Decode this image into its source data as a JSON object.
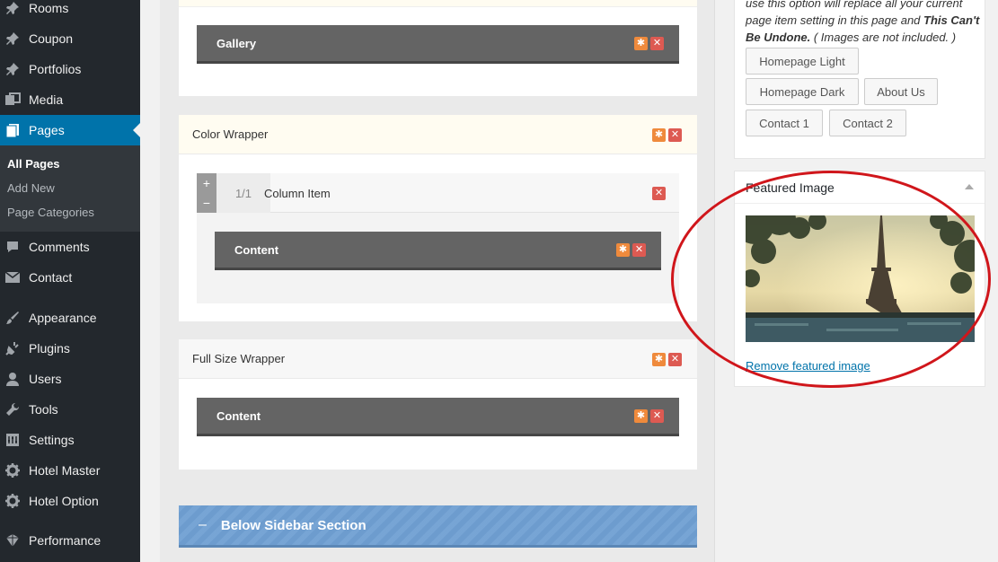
{
  "sidebar": {
    "items": [
      {
        "label": "Rooms",
        "icon": "pin-icon"
      },
      {
        "label": "Coupon",
        "icon": "pin-icon"
      },
      {
        "label": "Portfolios",
        "icon": "pin-icon"
      },
      {
        "label": "Media",
        "icon": "media-icon"
      },
      {
        "label": "Pages",
        "icon": "pages-icon"
      },
      {
        "label": "Comments",
        "icon": "comments-icon"
      },
      {
        "label": "Contact",
        "icon": "envelope-icon"
      },
      {
        "label": "Appearance",
        "icon": "brush-icon"
      },
      {
        "label": "Plugins",
        "icon": "plug-icon"
      },
      {
        "label": "Users",
        "icon": "user-icon"
      },
      {
        "label": "Tools",
        "icon": "wrench-icon"
      },
      {
        "label": "Settings",
        "icon": "settings-icon"
      },
      {
        "label": "Hotel Master",
        "icon": "gear-icon"
      },
      {
        "label": "Hotel Option",
        "icon": "gear-icon"
      },
      {
        "label": "Performance",
        "icon": "performance-icon"
      }
    ],
    "submenu": [
      "All Pages",
      "Add New",
      "Page Categories"
    ]
  },
  "builder": {
    "gallery_label": "Gallery",
    "color_wrapper_label": "Color Wrapper",
    "column_fraction": "1/1",
    "column_item_label": "Column Item",
    "content_label": "Content",
    "full_size_wrapper_label": "Full Size Wrapper",
    "content_label_2": "Content",
    "section_minus": "–",
    "section_label": "Below Sidebar Section"
  },
  "right_panel": {
    "warn_prefix": "use this option will replace all your current page item setting in this page and",
    "warn_bold": "This Can't Be Undone.",
    "warn_suffix": "( Images are not included. )",
    "buttons": [
      "Homepage Light",
      "Homepage Dark",
      "About Us",
      "Contact 1",
      "Contact 2"
    ],
    "featured_title": "Featured Image",
    "remove_link": "Remove featured image"
  },
  "colors": {
    "sidebar_bg": "#23282d",
    "active_blue": "#0073aa",
    "section_blue": "#6f9fd2",
    "gear_orange": "#ef8a3c",
    "close_red": "#dd5a52",
    "annotation_red": "#d0161b"
  }
}
